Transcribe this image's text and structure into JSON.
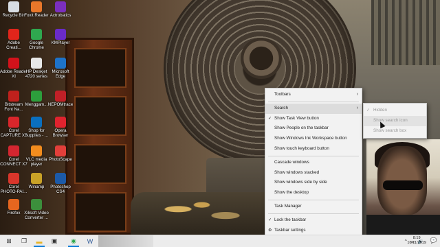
{
  "desktop_icons": [
    {
      "label": "Recycle Bin",
      "icon": "recycle-bin-icon",
      "color": "#d8dde4"
    },
    {
      "label": "Foxit Reader",
      "icon": "foxit-reader-icon",
      "color": "#e8772a"
    },
    {
      "label": "Actrobatics",
      "icon": "actrobatics-icon",
      "color": "#7b2fbf"
    },
    {
      "label": "Adobe Creati...",
      "icon": "adobe-creative-cloud-icon",
      "color": "#e1251b"
    },
    {
      "label": "Google Chrome",
      "icon": "google-chrome-icon",
      "color": "#2fa84f"
    },
    {
      "label": "KMPlayer",
      "icon": "kmplayer-icon",
      "color": "#6a2bc8"
    },
    {
      "label": "Adobe Reader XI",
      "icon": "adobe-reader-icon",
      "color": "#d3121b"
    },
    {
      "label": "HP Deskjet 4720 series",
      "icon": "hp-printer-icon",
      "color": "#e8e8e8"
    },
    {
      "label": "Microsoft Edge",
      "icon": "microsoft-edge-icon",
      "color": "#1e73c9"
    },
    {
      "label": "Bitstream Font Na...",
      "icon": "bitstream-font-icon",
      "color": "#c0211d"
    },
    {
      "label": "Menggam...",
      "icon": "menggambar-icon",
      "color": "#2d9e3c"
    },
    {
      "label": "NEPOMtrace",
      "icon": "nepom-icon",
      "color": "#c02027"
    },
    {
      "label": "Corel CAPTURE X7",
      "icon": "corel-capture-icon",
      "color": "#d9262b"
    },
    {
      "label": "Shop for Supplies - ...",
      "icon": "hp-supplies-icon",
      "color": "#0a6fbf"
    },
    {
      "label": "Opera Browser",
      "icon": "opera-icon",
      "color": "#e0232e"
    },
    {
      "label": "Corel CONNECT X7",
      "icon": "corel-connect-icon",
      "color": "#d42630"
    },
    {
      "label": "VLC media player",
      "icon": "vlc-icon",
      "color": "#f28c1e"
    },
    {
      "label": "PhotoScape",
      "icon": "photoscape-icon",
      "color": "#e23f3a"
    },
    {
      "label": "Corel PHOTO-PAI...",
      "icon": "corel-photo-paint-icon",
      "color": "#d9362b"
    },
    {
      "label": "Winamp",
      "icon": "winamp-icon",
      "color": "#c9a227"
    },
    {
      "label": "Photoshop CS4",
      "icon": "photoshop-icon",
      "color": "#1c5aa8"
    },
    {
      "label": "Firefox",
      "icon": "firefox-icon",
      "color": "#e5661f"
    },
    {
      "label": "Xilisoft Video Converter ...",
      "icon": "xilisoft-icon",
      "color": "#3c8f3c"
    }
  ],
  "context_menu": {
    "items": [
      {
        "label": "Toolbars",
        "has_submenu": true
      },
      {
        "separator": true
      },
      {
        "label": "Search",
        "has_submenu": true,
        "hover": true
      },
      {
        "label": "Show Task View button",
        "checked": true
      },
      {
        "label": "Show People on the taskbar"
      },
      {
        "label": "Show Windows Ink Workspace button"
      },
      {
        "label": "Show touch keyboard button"
      },
      {
        "separator": true
      },
      {
        "label": "Cascade windows"
      },
      {
        "label": "Show windows stacked"
      },
      {
        "label": "Show windows side by side"
      },
      {
        "label": "Show the desktop"
      },
      {
        "separator": true
      },
      {
        "label": "Task Manager"
      },
      {
        "separator": true
      },
      {
        "label": "Lock the taskbar",
        "checked": true
      },
      {
        "label": "Taskbar settings",
        "gear": true
      }
    ]
  },
  "search_submenu": {
    "items": [
      {
        "label": "Hidden",
        "checked": true
      },
      {
        "label": "Show search icon",
        "hover": true
      },
      {
        "label": "Show search box"
      }
    ]
  },
  "taskbar": {
    "buttons": [
      {
        "name": "start-button",
        "icon": "windows-logo-icon",
        "glyph": "⊞"
      },
      {
        "name": "task-view-button",
        "icon": "task-view-icon",
        "glyph": "❐"
      },
      {
        "name": "file-explorer-button",
        "icon": "folder-icon",
        "glyph": "▬",
        "color": "#e6b422",
        "active": true
      },
      {
        "name": "store-button",
        "icon": "store-bag-icon",
        "glyph": "▣"
      },
      {
        "name": "chrome-button",
        "icon": "chrome-icon",
        "glyph": "◉",
        "color": "#2fa84f",
        "active": true
      },
      {
        "name": "word-button",
        "icon": "word-icon",
        "glyph": "W",
        "color": "#2b5797"
      }
    ],
    "tray": {
      "chevron": "^",
      "network": "▭",
      "volume": "🔊"
    },
    "clock": {
      "time": "8:19",
      "date": "10/11/2019"
    },
    "notifications_icon": "💬"
  }
}
